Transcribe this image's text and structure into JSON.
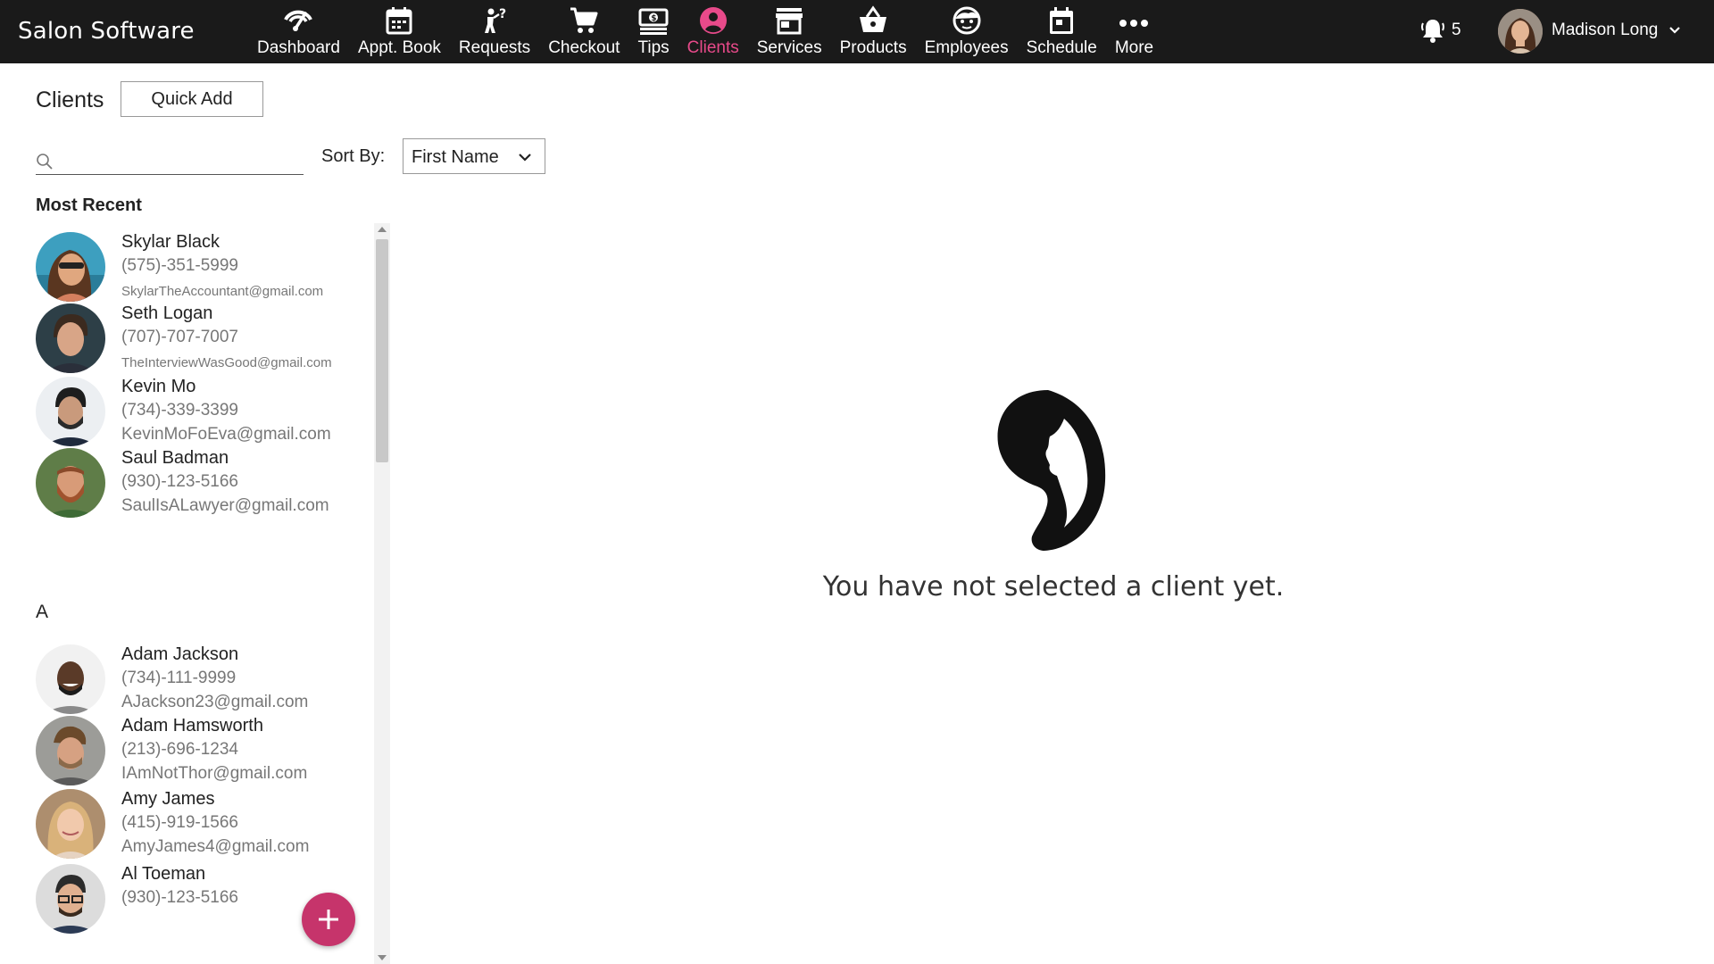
{
  "app": {
    "brand": "Salon Software"
  },
  "nav": {
    "items": [
      {
        "label": "Dashboard",
        "icon": "dashboard-icon"
      },
      {
        "label": "Appt. Book",
        "icon": "calendar-icon"
      },
      {
        "label": "Requests",
        "icon": "person-question-icon"
      },
      {
        "label": "Checkout",
        "icon": "cart-icon"
      },
      {
        "label": "Tips",
        "icon": "money-icon"
      },
      {
        "label": "Clients",
        "icon": "user-circle-icon",
        "active": true
      },
      {
        "label": "Services",
        "icon": "store-icon"
      },
      {
        "label": "Products",
        "icon": "basket-icon"
      },
      {
        "label": "Employees",
        "icon": "face-icon"
      },
      {
        "label": "Schedule",
        "icon": "schedule-icon"
      },
      {
        "label": "More",
        "icon": "more-dots-icon"
      }
    ],
    "active_color": "#e84a8a"
  },
  "header": {
    "notification_count": "5",
    "user_name": "Madison Long"
  },
  "clients_page": {
    "title": "Clients",
    "quick_add_label": "Quick Add",
    "search_placeholder": "",
    "sort_label": "Sort By:",
    "sort_value": "First Name",
    "most_recent_label": "Most Recent",
    "section_a_label": "A",
    "most_recent": [
      {
        "name": "Skylar Black",
        "phone": "(575)-351-5999",
        "email": "SkylarTheAccountant@gmail.com"
      },
      {
        "name": "Seth Logan",
        "phone": "(707)-707-7007",
        "email": "TheInterviewWasGood@gmail.com"
      },
      {
        "name": "Kevin Mo",
        "phone": "(734)-339-3399",
        "email": "KevinMoFoEva@gmail.com"
      },
      {
        "name": "Saul Badman",
        "phone": "(930)-123-5166",
        "email": "SaulIsALawyer@gmail.com"
      }
    ],
    "section_a": [
      {
        "name": "Adam Jackson",
        "phone": "(734)-111-9999",
        "email": "AJackson23@gmail.com"
      },
      {
        "name": "Adam Hamsworth",
        "phone": "(213)-696-1234",
        "email": "IAmNotThor@gmail.com"
      },
      {
        "name": "Amy James",
        "phone": "(415)-919-1566",
        "email": "AmyJames4@gmail.com"
      },
      {
        "name": "Al Toeman",
        "phone": "(930)-123-5166",
        "email": ""
      }
    ]
  },
  "empty_state": {
    "message": "You have not selected a client yet."
  },
  "colors": {
    "topbar": "#1a1a1a",
    "fab": "#c6346b"
  }
}
